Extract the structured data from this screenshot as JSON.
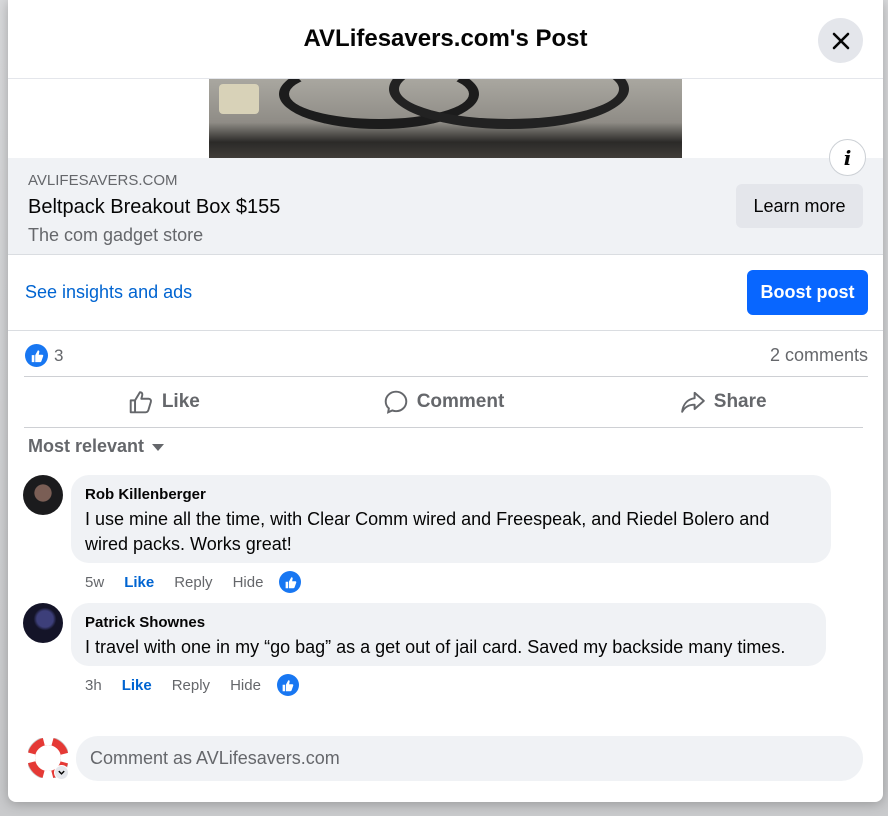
{
  "header": {
    "title": "AVLifesavers.com's Post"
  },
  "link_card": {
    "domain": "AVLIFESAVERS.COM",
    "title": "Beltpack Breakout Box $155",
    "subtitle": "The com gadget store",
    "cta_label": "Learn more"
  },
  "insights": {
    "link_label": "See insights and ads",
    "boost_label": "Boost post"
  },
  "stats": {
    "like_count": "3",
    "comments_count": "2 comments"
  },
  "actions": {
    "like": "Like",
    "comment": "Comment",
    "share": "Share"
  },
  "sort": {
    "label": "Most relevant"
  },
  "comments": [
    {
      "author": "Rob Killenberger",
      "text_line1": "I use mine all the time, with Clear Comm wired and Freespeak, and Riedel Bolero and",
      "text_line2": "wired packs. Works great!",
      "time": "5w",
      "like": "Like",
      "reply": "Reply",
      "hide": "Hide"
    },
    {
      "author": "Patrick Shownes",
      "text_line1": "I travel with one in my “go bag” as a get out of jail card. Saved my backside many times.",
      "time": "3h",
      "like": "Like",
      "reply": "Reply",
      "hide": "Hide"
    }
  ],
  "composer": {
    "placeholder": "Comment as AVLifesavers.com"
  },
  "colors": {
    "accent": "#0866ff",
    "link": "#0064d1",
    "surface": "#f0f2f5"
  }
}
